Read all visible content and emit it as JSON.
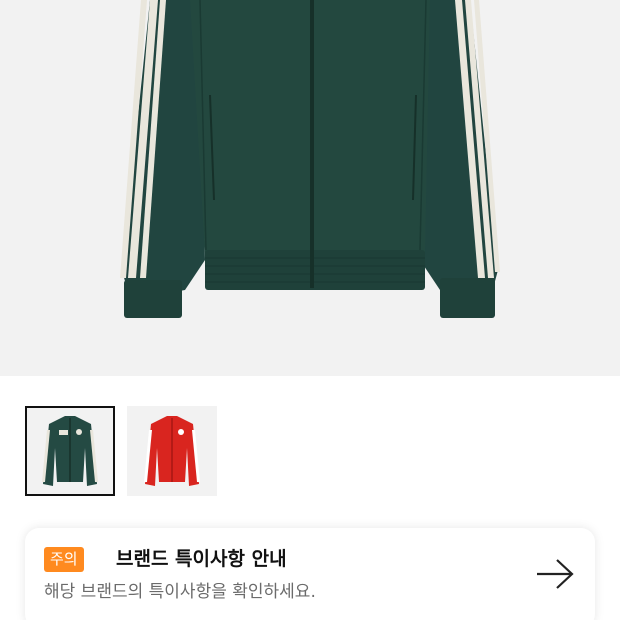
{
  "product": {
    "images": [
      {
        "name": "green track jacket",
        "color": "#244a43",
        "selected": true
      },
      {
        "name": "red track jacket",
        "color": "#d9251f",
        "selected": false
      }
    ]
  },
  "notice": {
    "badge": "주의",
    "title": "브랜드 특이사항 안내",
    "subtitle": "해당 브랜드의 특이사항을 확인하세요.",
    "arrow_icon": "arrow-right-icon",
    "badge_color": "#ff8a1f"
  }
}
